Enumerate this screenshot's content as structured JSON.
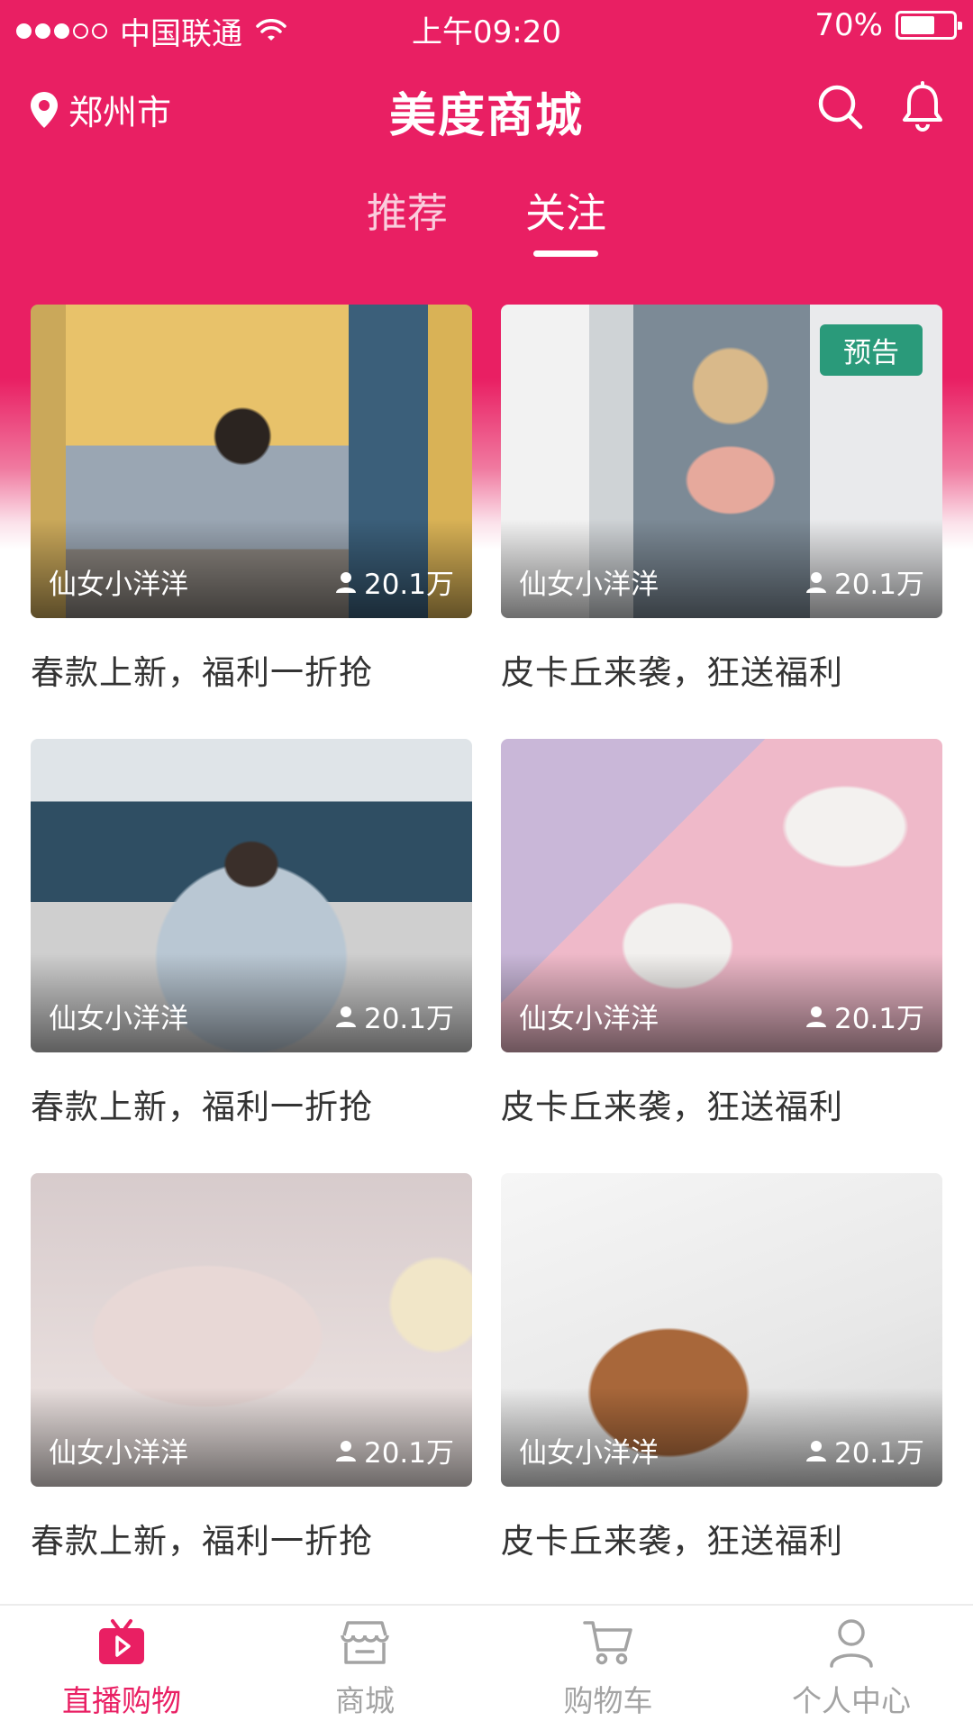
{
  "status_bar": {
    "carrier": "中国联通",
    "time": "上午09:20",
    "battery": "70%",
    "battery_level": 0.7
  },
  "header": {
    "location": "郑州市",
    "title": "美度商城",
    "icons": [
      "location-pin-icon",
      "search-icon",
      "bell-icon"
    ]
  },
  "tabs": [
    {
      "label": "推荐",
      "active": false
    },
    {
      "label": "关注",
      "active": true
    }
  ],
  "cards": [
    {
      "host": "仙女小洋洋",
      "views": "20.1万",
      "title": "春款上新，福利一折抢",
      "badge": ""
    },
    {
      "host": "仙女小洋洋",
      "views": "20.1万",
      "title": "皮卡丘来袭，狂送福利",
      "badge": "预告"
    },
    {
      "host": "仙女小洋洋",
      "views": "20.1万",
      "title": "春款上新，福利一折抢",
      "badge": ""
    },
    {
      "host": "仙女小洋洋",
      "views": "20.1万",
      "title": "皮卡丘来袭，狂送福利",
      "badge": ""
    },
    {
      "host": "仙女小洋洋",
      "views": "20.1万",
      "title": "春款上新，福利一折抢",
      "badge": ""
    },
    {
      "host": "仙女小洋洋",
      "views": "20.1万",
      "title": "皮卡丘来袭，狂送福利",
      "badge": ""
    }
  ],
  "bottom_nav": [
    {
      "label": "直播购物",
      "icon": "live-tv-icon",
      "active": true
    },
    {
      "label": "商城",
      "icon": "store-icon",
      "active": false
    },
    {
      "label": "购物车",
      "icon": "cart-icon",
      "active": false
    },
    {
      "label": "个人中心",
      "icon": "user-icon",
      "active": false
    }
  ],
  "colors": {
    "brand": "#e91f63",
    "badge": "#2a9a7a",
    "inactive": "#a3a3a3",
    "text": "#333333"
  }
}
